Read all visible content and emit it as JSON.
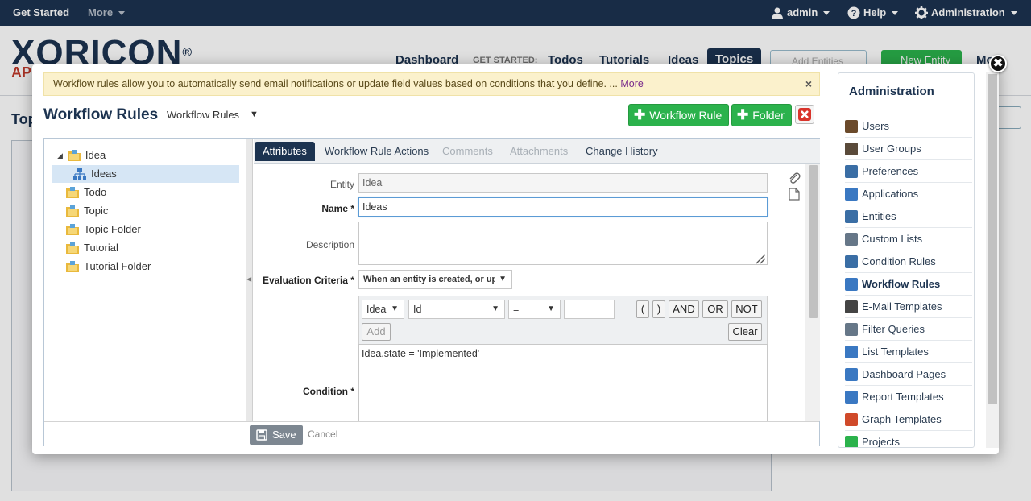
{
  "topbar": {
    "get_started": "Get Started",
    "more": "More",
    "user": "admin",
    "help": "Help",
    "administration": "Administration"
  },
  "background": {
    "logo": "XORICON",
    "logo_reg": "®",
    "logo_sub": "AP",
    "nav": {
      "dashboard": "Dashboard",
      "get_started_label": "GET STARTED:",
      "todos": "Todos",
      "tutorials": "Tutorials",
      "ideas": "Ideas",
      "topics": "Topics",
      "more": "Mo"
    },
    "search_placeholder": "Add Entities",
    "new_entity": "New Entity",
    "page_title": "Top"
  },
  "dialog": {
    "notice": {
      "text": "Workflow rules allow you to automatically send email notifications or update field values based on conditions that you define. ...",
      "more": "More",
      "close": "×"
    },
    "title": "Workflow Rules",
    "selector": "Workflow Rules",
    "buttons": {
      "workflow_rule": "Workflow Rule",
      "folder": "Folder"
    },
    "tree": [
      {
        "label": "Idea",
        "expanded": true
      },
      {
        "label": "Ideas",
        "selected": true
      },
      {
        "label": "Todo"
      },
      {
        "label": "Topic"
      },
      {
        "label": "Topic Folder"
      },
      {
        "label": "Tutorial"
      },
      {
        "label": "Tutorial Folder"
      }
    ],
    "tabs": [
      {
        "label": "Attributes",
        "active": true
      },
      {
        "label": "Workflow Rule Actions"
      },
      {
        "label": "Comments",
        "disabled": true
      },
      {
        "label": "Attachments",
        "disabled": true
      },
      {
        "label": "Change History"
      }
    ],
    "form": {
      "entity_label": "Entity",
      "entity_value": "Idea",
      "name_label": "Name *",
      "name_value": "Ideas",
      "description_label": "Description",
      "description_value": "",
      "eval_label": "Evaluation Criteria *",
      "eval_value": "When an entity is created, or upd",
      "condition_label": "Condition *",
      "cond_entity": "Idea",
      "cond_field": "Id",
      "cond_op": "=",
      "cond_value": "",
      "btn_lparen": "(",
      "btn_rparen": ")",
      "btn_and": "AND",
      "btn_or": "OR",
      "btn_not": "NOT",
      "btn_add": "Add",
      "btn_clear": "Clear",
      "condition_text": "Idea.state = 'Implemented'"
    },
    "save": "Save",
    "cancel": "Cancel",
    "close": "✖"
  },
  "admin": {
    "title": "Administration",
    "items": [
      {
        "label": "Users",
        "icon": "user-icon",
        "color": "#6b4a2b"
      },
      {
        "label": "User Groups",
        "icon": "user-groups-icon",
        "color": "#5a4a3a"
      },
      {
        "label": "Preferences",
        "icon": "tools-icon",
        "color": "#3a6ea5"
      },
      {
        "label": "Applications",
        "icon": "window-icon",
        "color": "#3a78c2"
      },
      {
        "label": "Entities",
        "icon": "gear-icon",
        "color": "#3a6ea5"
      },
      {
        "label": "Custom Lists",
        "icon": "search-list-icon",
        "color": "#667788"
      },
      {
        "label": "Condition Rules",
        "icon": "condition-icon",
        "color": "#3a6ea5"
      },
      {
        "label": "Workflow Rules",
        "icon": "workflow-icon",
        "color": "#3a78c2",
        "active": true
      },
      {
        "label": "E-Mail Templates",
        "icon": "mail-icon",
        "color": "#444444"
      },
      {
        "label": "Filter Queries",
        "icon": "filter-icon",
        "color": "#667788"
      },
      {
        "label": "List Templates",
        "icon": "list-icon",
        "color": "#3a78c2"
      },
      {
        "label": "Dashboard Pages",
        "icon": "dashboard-icon",
        "color": "#3a78c2"
      },
      {
        "label": "Report Templates",
        "icon": "report-icon",
        "color": "#3a78c2"
      },
      {
        "label": "Graph Templates",
        "icon": "pie-chart-icon",
        "color": "#d04a2a"
      },
      {
        "label": "Projects",
        "icon": "projects-icon",
        "color": "#2bb24c"
      }
    ]
  }
}
